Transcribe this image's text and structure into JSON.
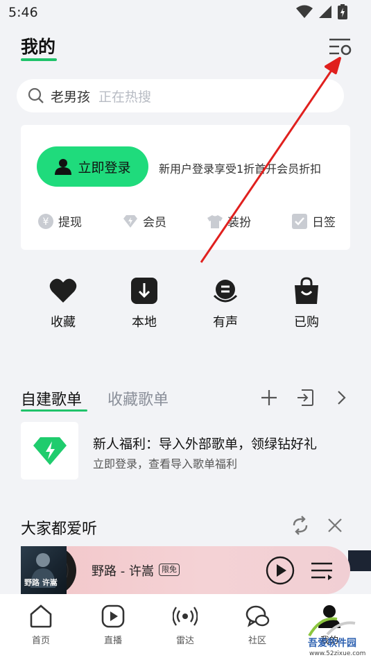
{
  "status_bar": {
    "time": "5:46"
  },
  "header": {
    "title": "我的"
  },
  "search": {
    "query": "老男孩",
    "hint": "正在热搜"
  },
  "login_card": {
    "login_label": "立即登录",
    "promo": "新用户登录享受1折首开会员折扣",
    "quick_links": [
      {
        "label": "提现",
        "icon": "withdraw-icon"
      },
      {
        "label": "会员",
        "icon": "diamond-icon"
      },
      {
        "label": "装扮",
        "icon": "shirt-icon"
      },
      {
        "label": "日签",
        "icon": "check-icon"
      }
    ]
  },
  "shortcuts": [
    {
      "label": "收藏",
      "icon": "heart-icon"
    },
    {
      "label": "本地",
      "icon": "download-icon"
    },
    {
      "label": "有声",
      "icon": "audiobook-icon"
    },
    {
      "label": "已购",
      "icon": "bag-icon"
    }
  ],
  "playlists": {
    "tab_active": "自建歌单",
    "tab_inactive": "收藏歌单",
    "new_user_title": "新人福利：导入外部歌单，领绿钻好礼",
    "new_user_sub": "立即登录，查看导入歌单福利"
  },
  "recommend": {
    "title": "大家都爱听"
  },
  "player": {
    "song": "野路 - 许嵩",
    "badge": "限免",
    "art_text": "野路 许嵩"
  },
  "tab_bar": [
    {
      "label": "首页",
      "icon": "home-icon"
    },
    {
      "label": "直播",
      "icon": "live-icon"
    },
    {
      "label": "雷达",
      "icon": "radar-icon"
    },
    {
      "label": "社区",
      "icon": "community-icon"
    },
    {
      "label": "我的",
      "icon": "profile-icon"
    }
  ],
  "watermark": {
    "brand": "吾爱软件园",
    "url": "www.52zixue.com"
  },
  "colors": {
    "accent": "#1fdb7c",
    "underline": "#20c36a",
    "arrow": "#e0201e"
  }
}
